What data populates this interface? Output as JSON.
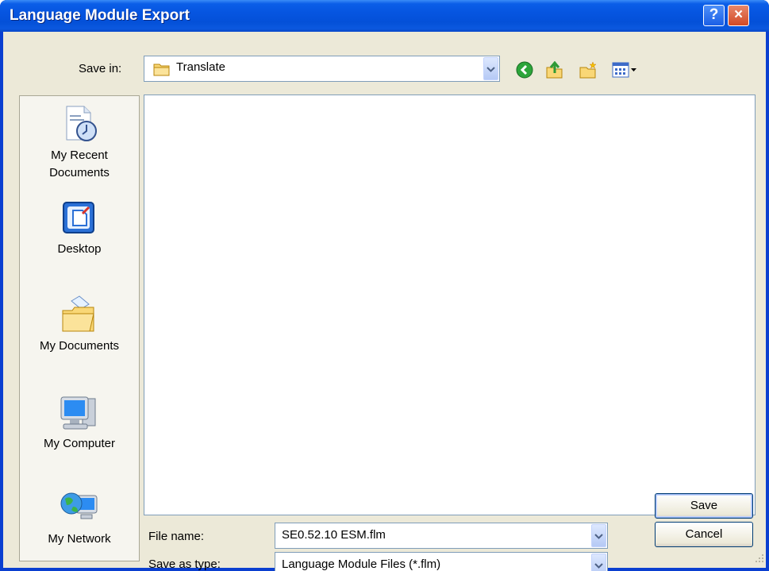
{
  "window": {
    "title": "Language Module Export",
    "help_glyph": "?",
    "close_glyph": "×"
  },
  "toolbar": {
    "save_in_label": "Save in:",
    "save_in_value": "Translate",
    "icons": [
      "back-icon",
      "up-folder-icon",
      "new-folder-icon",
      "views-menu-icon"
    ]
  },
  "places": [
    {
      "label_lines": [
        "My Recent",
        "Documents"
      ],
      "icon": "recent-documents-icon"
    },
    {
      "label_lines": [
        "Desktop"
      ],
      "icon": "desktop-icon"
    },
    {
      "label_lines": [
        "My Documents"
      ],
      "icon": "my-documents-icon"
    },
    {
      "label_lines": [
        "My Computer"
      ],
      "icon": "my-computer-icon"
    },
    {
      "label_lines": [
        "My Network"
      ],
      "icon": "my-network-icon"
    }
  ],
  "form": {
    "file_name_label": "File name:",
    "file_name_value": "SE0.52.10 ESM.flm",
    "save_type_label": "Save as type:",
    "save_type_value": "Language Module Files (*.flm)"
  },
  "buttons": {
    "save": "Save",
    "cancel": "Cancel"
  },
  "colors": {
    "titlebar": "#0655e0",
    "dialog_face": "#ece9d8",
    "close_button": "#d24a25",
    "field_border": "#7f9db9"
  }
}
